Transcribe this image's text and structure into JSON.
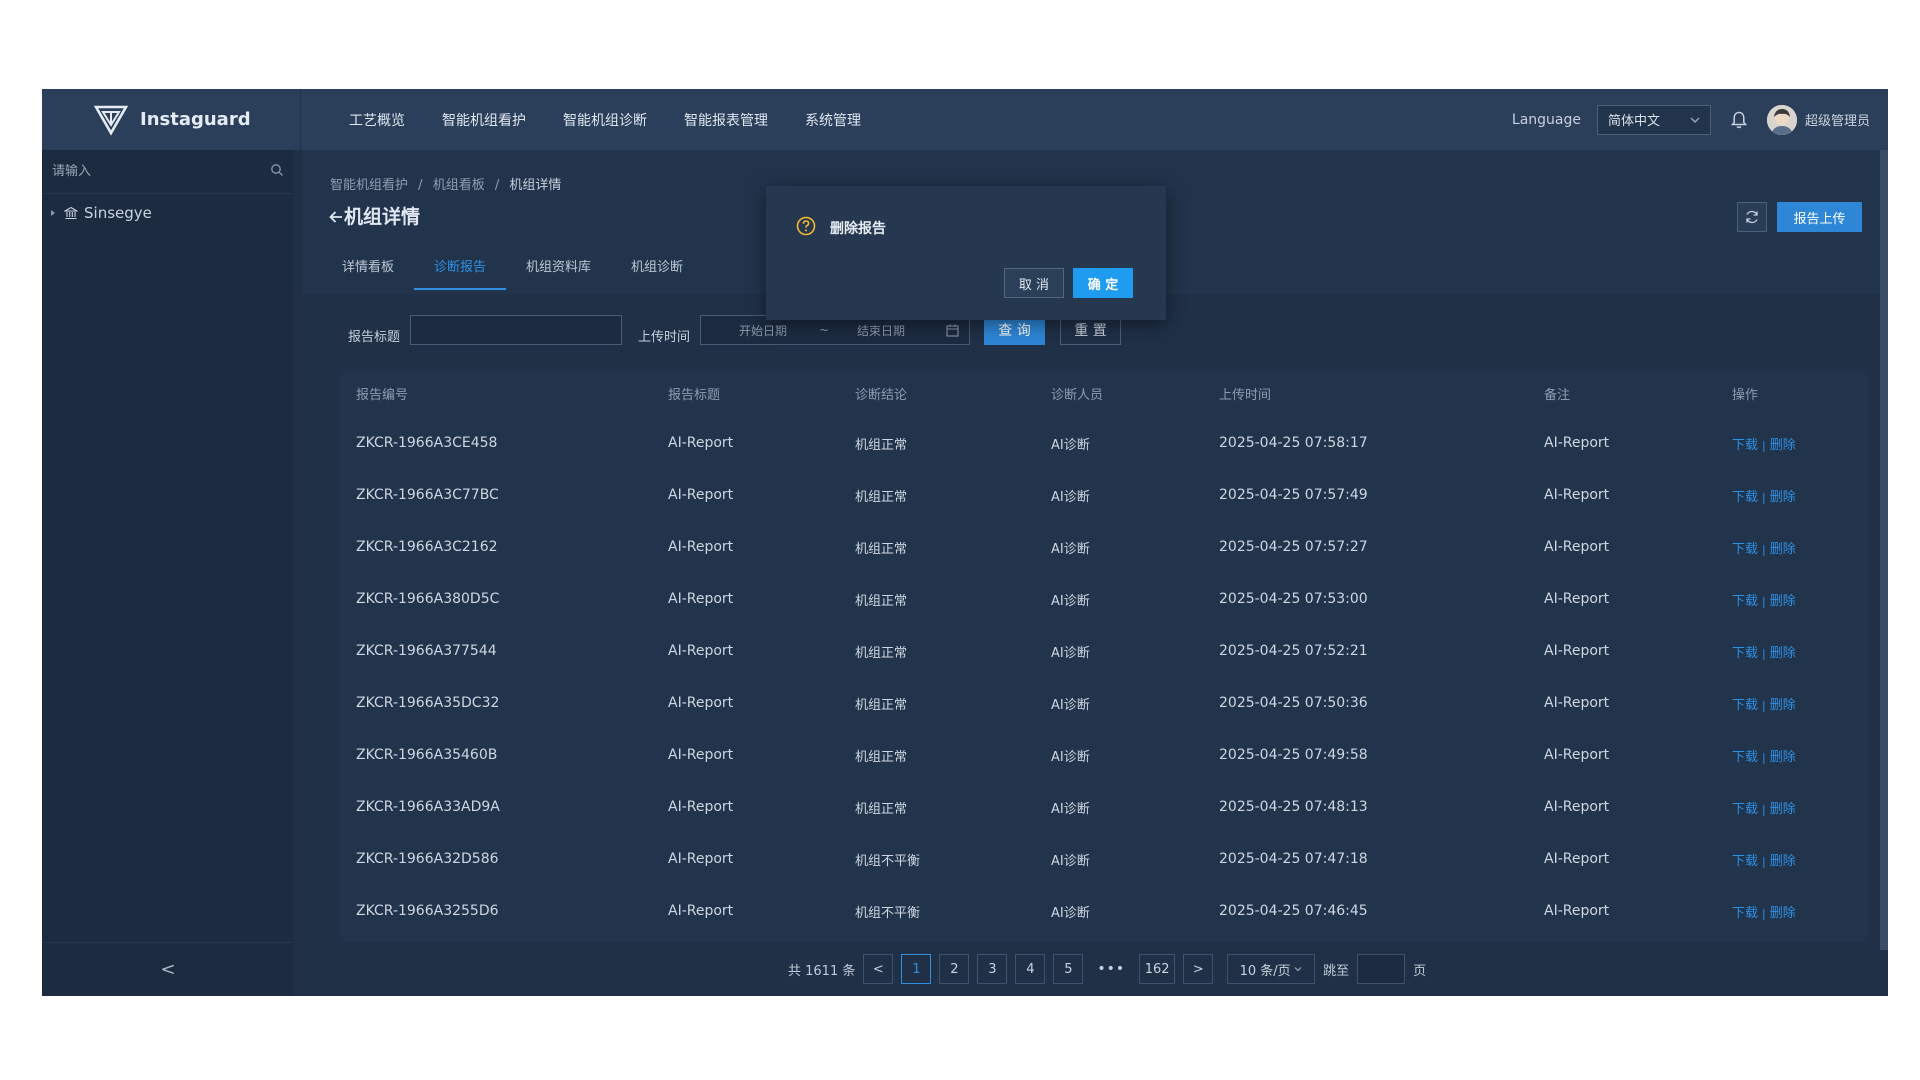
{
  "app": {
    "name": "Instaguard"
  },
  "nav": [
    "工艺概览",
    "智能机组看护",
    "智能机组诊断",
    "智能报表管理",
    "系统管理"
  ],
  "header": {
    "language_label": "Language",
    "language_value": "简体中文",
    "user_name": "超级管理员"
  },
  "sidebar": {
    "search_placeholder": "请输入",
    "tree_root": "Sinsegye",
    "collapse_label": "<"
  },
  "breadcrumb": [
    "智能机组看护",
    "机组看板",
    "机组详情"
  ],
  "breadcrumb_sep": "/",
  "page_title": "机组详情",
  "tabs": [
    {
      "label": "详情看板",
      "active": false
    },
    {
      "label": "诊断报告",
      "active": true
    },
    {
      "label": "机组资料库",
      "active": false
    },
    {
      "label": "机组诊断",
      "active": false
    }
  ],
  "toolbar": {
    "upload_label": "报告上传"
  },
  "filter": {
    "title_label": "报告标题",
    "time_label": "上传时间",
    "start_placeholder": "开始日期",
    "range_sep": "~",
    "end_placeholder": "结束日期",
    "query_label": "查 询",
    "reset_label": "重 置"
  },
  "table": {
    "columns": [
      "报告编号",
      "报告标题",
      "诊断结论",
      "诊断人员",
      "上传时间",
      "备注",
      "操作"
    ],
    "action_download": "下载",
    "action_delete": "删除",
    "action_sep": "|",
    "rows": [
      [
        "ZKCR-1966A3CE458",
        "AI-Report",
        "机组正常",
        "AI诊断",
        "2025-04-25 07:58:17",
        "AI-Report"
      ],
      [
        "ZKCR-1966A3C77BC",
        "AI-Report",
        "机组正常",
        "AI诊断",
        "2025-04-25 07:57:49",
        "AI-Report"
      ],
      [
        "ZKCR-1966A3C2162",
        "AI-Report",
        "机组正常",
        "AI诊断",
        "2025-04-25 07:57:27",
        "AI-Report"
      ],
      [
        "ZKCR-1966A380D5C",
        "AI-Report",
        "机组正常",
        "AI诊断",
        "2025-04-25 07:53:00",
        "AI-Report"
      ],
      [
        "ZKCR-1966A377544",
        "AI-Report",
        "机组正常",
        "AI诊断",
        "2025-04-25 07:52:21",
        "AI-Report"
      ],
      [
        "ZKCR-1966A35DC32",
        "AI-Report",
        "机组正常",
        "AI诊断",
        "2025-04-25 07:50:36",
        "AI-Report"
      ],
      [
        "ZKCR-1966A35460B",
        "AI-Report",
        "机组正常",
        "AI诊断",
        "2025-04-25 07:49:58",
        "AI-Report"
      ],
      [
        "ZKCR-1966A33AD9A",
        "AI-Report",
        "机组正常",
        "AI诊断",
        "2025-04-25 07:48:13",
        "AI-Report"
      ],
      [
        "ZKCR-1966A32D586",
        "AI-Report",
        "机组不平衡",
        "AI诊断",
        "2025-04-25 07:47:18",
        "AI-Report"
      ],
      [
        "ZKCR-1966A3255D6",
        "AI-Report",
        "机组不平衡",
        "AI诊断",
        "2025-04-25 07:46:45",
        "AI-Report"
      ]
    ]
  },
  "pagination": {
    "total": "共 1611 条",
    "prev": "<",
    "pages": [
      "1",
      "2",
      "3",
      "4",
      "5"
    ],
    "current": "1",
    "ellipsis": "•••",
    "last": "162",
    "next": ">",
    "page_size": "10 条/页",
    "jump_label": "跳至",
    "page_suffix": "页"
  },
  "dialog": {
    "title": "删除报告",
    "cancel_label": "取 消",
    "ok_label": "确 定"
  },
  "colors": {
    "accent": "#2e86d6",
    "dialog_ok": "#1f9bf0",
    "warning": "#f5b82e",
    "background": "#1b2a40"
  }
}
